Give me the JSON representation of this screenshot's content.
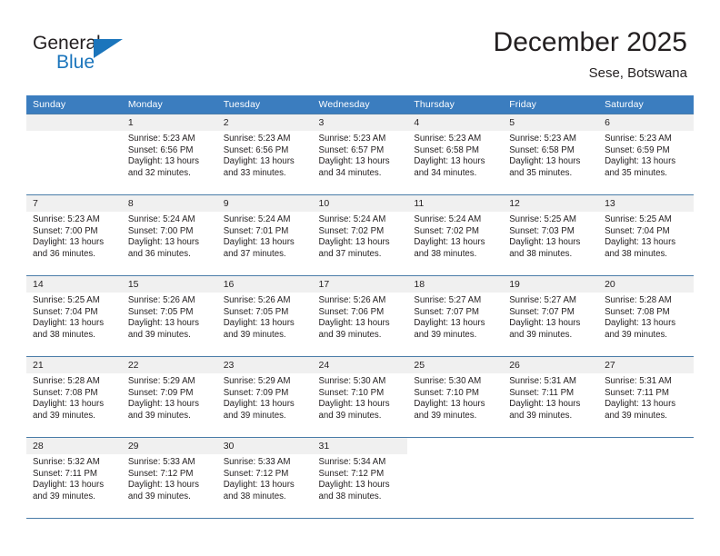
{
  "brand": {
    "name_top": "General",
    "name_bottom": "Blue",
    "accent_color": "#1b75bc",
    "triangle_icon": "brand-triangle-icon"
  },
  "header": {
    "title": "December 2025",
    "subtitle": "Sese, Botswana"
  },
  "colors": {
    "header_band": "#3b7dbf",
    "daynum_band": "#f0f0f0",
    "grid_line": "#4a7ca8",
    "text": "#231f20"
  },
  "weekday_headers": [
    "Sunday",
    "Monday",
    "Tuesday",
    "Wednesday",
    "Thursday",
    "Friday",
    "Saturday"
  ],
  "labels": {
    "sunrise_prefix": "Sunrise:",
    "sunset_prefix": "Sunset:",
    "daylight_prefix": "Daylight:"
  },
  "weeks": [
    [
      {
        "day": "",
        "blank": true
      },
      {
        "day": "1",
        "sunrise": "Sunrise: 5:23 AM",
        "sunset": "Sunset: 6:56 PM",
        "daylight": "Daylight: 13 hours and 32 minutes."
      },
      {
        "day": "2",
        "sunrise": "Sunrise: 5:23 AM",
        "sunset": "Sunset: 6:56 PM",
        "daylight": "Daylight: 13 hours and 33 minutes."
      },
      {
        "day": "3",
        "sunrise": "Sunrise: 5:23 AM",
        "sunset": "Sunset: 6:57 PM",
        "daylight": "Daylight: 13 hours and 34 minutes."
      },
      {
        "day": "4",
        "sunrise": "Sunrise: 5:23 AM",
        "sunset": "Sunset: 6:58 PM",
        "daylight": "Daylight: 13 hours and 34 minutes."
      },
      {
        "day": "5",
        "sunrise": "Sunrise: 5:23 AM",
        "sunset": "Sunset: 6:58 PM",
        "daylight": "Daylight: 13 hours and 35 minutes."
      },
      {
        "day": "6",
        "sunrise": "Sunrise: 5:23 AM",
        "sunset": "Sunset: 6:59 PM",
        "daylight": "Daylight: 13 hours and 35 minutes."
      }
    ],
    [
      {
        "day": "7",
        "sunrise": "Sunrise: 5:23 AM",
        "sunset": "Sunset: 7:00 PM",
        "daylight": "Daylight: 13 hours and 36 minutes."
      },
      {
        "day": "8",
        "sunrise": "Sunrise: 5:24 AM",
        "sunset": "Sunset: 7:00 PM",
        "daylight": "Daylight: 13 hours and 36 minutes."
      },
      {
        "day": "9",
        "sunrise": "Sunrise: 5:24 AM",
        "sunset": "Sunset: 7:01 PM",
        "daylight": "Daylight: 13 hours and 37 minutes."
      },
      {
        "day": "10",
        "sunrise": "Sunrise: 5:24 AM",
        "sunset": "Sunset: 7:02 PM",
        "daylight": "Daylight: 13 hours and 37 minutes."
      },
      {
        "day": "11",
        "sunrise": "Sunrise: 5:24 AM",
        "sunset": "Sunset: 7:02 PM",
        "daylight": "Daylight: 13 hours and 38 minutes."
      },
      {
        "day": "12",
        "sunrise": "Sunrise: 5:25 AM",
        "sunset": "Sunset: 7:03 PM",
        "daylight": "Daylight: 13 hours and 38 minutes."
      },
      {
        "day": "13",
        "sunrise": "Sunrise: 5:25 AM",
        "sunset": "Sunset: 7:04 PM",
        "daylight": "Daylight: 13 hours and 38 minutes."
      }
    ],
    [
      {
        "day": "14",
        "sunrise": "Sunrise: 5:25 AM",
        "sunset": "Sunset: 7:04 PM",
        "daylight": "Daylight: 13 hours and 38 minutes."
      },
      {
        "day": "15",
        "sunrise": "Sunrise: 5:26 AM",
        "sunset": "Sunset: 7:05 PM",
        "daylight": "Daylight: 13 hours and 39 minutes."
      },
      {
        "day": "16",
        "sunrise": "Sunrise: 5:26 AM",
        "sunset": "Sunset: 7:05 PM",
        "daylight": "Daylight: 13 hours and 39 minutes."
      },
      {
        "day": "17",
        "sunrise": "Sunrise: 5:26 AM",
        "sunset": "Sunset: 7:06 PM",
        "daylight": "Daylight: 13 hours and 39 minutes."
      },
      {
        "day": "18",
        "sunrise": "Sunrise: 5:27 AM",
        "sunset": "Sunset: 7:07 PM",
        "daylight": "Daylight: 13 hours and 39 minutes."
      },
      {
        "day": "19",
        "sunrise": "Sunrise: 5:27 AM",
        "sunset": "Sunset: 7:07 PM",
        "daylight": "Daylight: 13 hours and 39 minutes."
      },
      {
        "day": "20",
        "sunrise": "Sunrise: 5:28 AM",
        "sunset": "Sunset: 7:08 PM",
        "daylight": "Daylight: 13 hours and 39 minutes."
      }
    ],
    [
      {
        "day": "21",
        "sunrise": "Sunrise: 5:28 AM",
        "sunset": "Sunset: 7:08 PM",
        "daylight": "Daylight: 13 hours and 39 minutes."
      },
      {
        "day": "22",
        "sunrise": "Sunrise: 5:29 AM",
        "sunset": "Sunset: 7:09 PM",
        "daylight": "Daylight: 13 hours and 39 minutes."
      },
      {
        "day": "23",
        "sunrise": "Sunrise: 5:29 AM",
        "sunset": "Sunset: 7:09 PM",
        "daylight": "Daylight: 13 hours and 39 minutes."
      },
      {
        "day": "24",
        "sunrise": "Sunrise: 5:30 AM",
        "sunset": "Sunset: 7:10 PM",
        "daylight": "Daylight: 13 hours and 39 minutes."
      },
      {
        "day": "25",
        "sunrise": "Sunrise: 5:30 AM",
        "sunset": "Sunset: 7:10 PM",
        "daylight": "Daylight: 13 hours and 39 minutes."
      },
      {
        "day": "26",
        "sunrise": "Sunrise: 5:31 AM",
        "sunset": "Sunset: 7:11 PM",
        "daylight": "Daylight: 13 hours and 39 minutes."
      },
      {
        "day": "27",
        "sunrise": "Sunrise: 5:31 AM",
        "sunset": "Sunset: 7:11 PM",
        "daylight": "Daylight: 13 hours and 39 minutes."
      }
    ],
    [
      {
        "day": "28",
        "sunrise": "Sunrise: 5:32 AM",
        "sunset": "Sunset: 7:11 PM",
        "daylight": "Daylight: 13 hours and 39 minutes."
      },
      {
        "day": "29",
        "sunrise": "Sunrise: 5:33 AM",
        "sunset": "Sunset: 7:12 PM",
        "daylight": "Daylight: 13 hours and 39 minutes."
      },
      {
        "day": "30",
        "sunrise": "Sunrise: 5:33 AM",
        "sunset": "Sunset: 7:12 PM",
        "daylight": "Daylight: 13 hours and 38 minutes."
      },
      {
        "day": "31",
        "sunrise": "Sunrise: 5:34 AM",
        "sunset": "Sunset: 7:12 PM",
        "daylight": "Daylight: 13 hours and 38 minutes."
      },
      {
        "day": "",
        "nofill": true
      },
      {
        "day": "",
        "nofill": true
      },
      {
        "day": "",
        "nofill": true
      }
    ]
  ]
}
